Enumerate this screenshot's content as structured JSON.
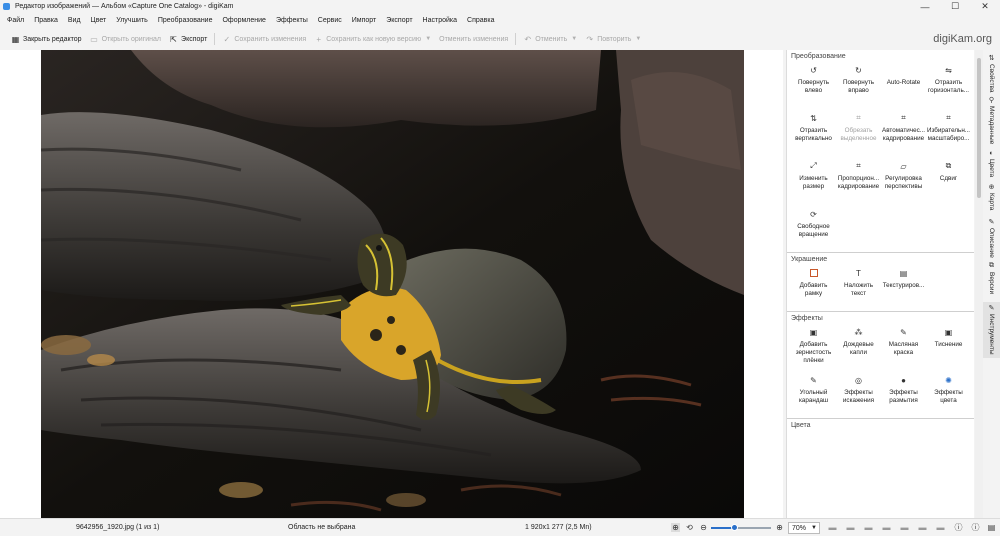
{
  "window": {
    "title": "Редактор изображений — Альбом «Capture One Catalog» - digiKam",
    "controls": [
      "—",
      "☐",
      "✕"
    ]
  },
  "menu": [
    "Файл",
    "Правка",
    "Вид",
    "Цвет",
    "Улучшить",
    "Преобразование",
    "Оформление",
    "Эффекты",
    "Сервис",
    "Импорт",
    "Экспорт",
    "Настройка",
    "Справка"
  ],
  "toolbar": {
    "close_editor": "Закрыть редактор",
    "open_original": "Открыть оригинал",
    "export": "Экспорт",
    "save_changes": "Сохранить изменения",
    "save_new_version": "Сохранить как новую версию",
    "undo_changes": "Отменить изменения",
    "undo": "Отменить",
    "redo": "Повторить",
    "brand": "digiKam.org"
  },
  "tools": {
    "transform": {
      "title": "Преобразование",
      "items": [
        {
          "label": "Повернуть влево",
          "icon": "rotate-left-icon",
          "glyph": "↺",
          "enabled": true
        },
        {
          "label": "Повернуть вправо",
          "icon": "rotate-right-icon",
          "glyph": "↻",
          "enabled": true
        },
        {
          "label": "Auto-Rotate",
          "icon": "auto-rotate-icon",
          "glyph": "",
          "enabled": true
        },
        {
          "label": "Отразить горизонталь...",
          "icon": "flip-horizontal-icon",
          "glyph": "⇋",
          "enabled": true
        },
        {
          "label": "Отразить вертикально",
          "icon": "flip-vertical-icon",
          "glyph": "⇅",
          "enabled": true
        },
        {
          "label": "Обрезать выделенное",
          "icon": "crop-selection-icon",
          "glyph": "⌗",
          "enabled": false
        },
        {
          "label": "Автоматичес... кадрирование",
          "icon": "auto-crop-icon",
          "glyph": "⌗",
          "enabled": true
        },
        {
          "label": "Избирательн... масштабиро...",
          "icon": "liquid-rescale-icon",
          "glyph": "⌗",
          "enabled": true
        },
        {
          "label": "Изменить размер",
          "icon": "resize-icon",
          "glyph": "⤢",
          "enabled": true
        },
        {
          "label": "Пропорцион... кадрирование",
          "icon": "ratio-crop-icon",
          "glyph": "⌗",
          "enabled": true
        },
        {
          "label": "Регулировка перспективы",
          "icon": "perspective-icon",
          "glyph": "▱",
          "enabled": true
        },
        {
          "label": "Сдвиг",
          "icon": "shear-icon",
          "glyph": "⧉",
          "enabled": true
        },
        {
          "label": "Свободное вращение",
          "icon": "free-rotation-icon",
          "glyph": "⟳",
          "enabled": true
        }
      ]
    },
    "decorate": {
      "title": "Украшение",
      "items": [
        {
          "label": "Добавить рамку",
          "icon": "border-icon",
          "glyph": "□",
          "enabled": true
        },
        {
          "label": "Наложить текст",
          "icon": "insert-text-icon",
          "glyph": "T",
          "enabled": true
        },
        {
          "label": "Текстуриров...",
          "icon": "texture-icon",
          "glyph": "▤",
          "enabled": true
        }
      ]
    },
    "effects": {
      "title": "Эффекты",
      "items": [
        {
          "label": "Добавить зернистость плёнки",
          "icon": "film-grain-icon",
          "glyph": "▣",
          "enabled": true
        },
        {
          "label": "Дождевые капли",
          "icon": "raindrops-icon",
          "glyph": "⁂",
          "enabled": true
        },
        {
          "label": "Масляная краска",
          "icon": "oil-paint-icon",
          "glyph": "✎",
          "enabled": true
        },
        {
          "label": "Тиснение",
          "icon": "emboss-icon",
          "glyph": "▣",
          "enabled": true
        },
        {
          "label": "Угольный карандаш",
          "icon": "charcoal-icon",
          "glyph": "✎",
          "enabled": true
        },
        {
          "label": "Эффекты искажения",
          "icon": "distortion-icon",
          "glyph": "◎",
          "enabled": true
        },
        {
          "label": "Эффекты размытия",
          "icon": "blur-fx-icon",
          "glyph": "●",
          "enabled": true
        },
        {
          "label": "Эффекты цвета",
          "icon": "color-fx-icon",
          "glyph": "✺",
          "enabled": true
        }
      ]
    },
    "colors": {
      "title": "Цвета"
    }
  },
  "side_tabs": [
    {
      "label": "Свойства",
      "icon": "properties-icon",
      "glyph": "⇅"
    },
    {
      "label": "Метаданные",
      "icon": "metadata-icon",
      "glyph": "⚲"
    },
    {
      "label": "Цвета",
      "icon": "colors-icon",
      "glyph": "◐"
    },
    {
      "label": "Карта",
      "icon": "map-icon",
      "glyph": "⊕"
    },
    {
      "label": "Описание",
      "icon": "caption-icon",
      "glyph": "✎"
    },
    {
      "label": "Версии",
      "icon": "versions-icon",
      "glyph": "⧉"
    },
    {
      "label": "Инструменты",
      "icon": "tools-icon",
      "glyph": "✎"
    }
  ],
  "status": {
    "filename": "9642956_1920.jpg (1 из 1)",
    "selection": "Область не выбрана",
    "dimensions": "1 920x1 277 (2,5 Mn)",
    "zoom": "70%",
    "zoom_fraction": 0.4
  },
  "colors": {
    "accent": "#2a6fc9"
  }
}
